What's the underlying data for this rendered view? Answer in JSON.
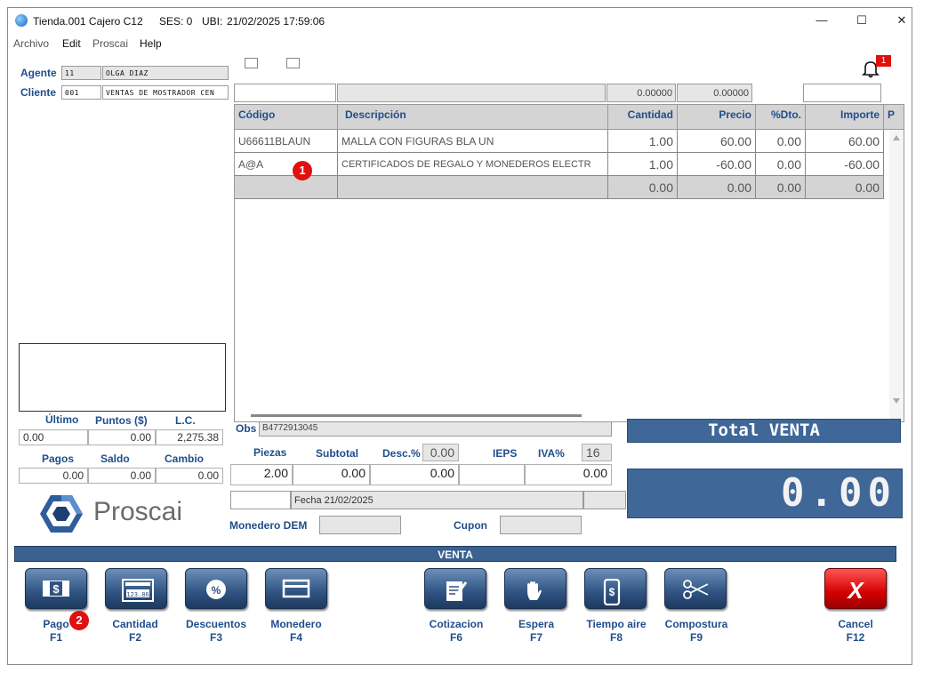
{
  "window": {
    "title": "Tienda.001  Cajero C12",
    "ses": "SES: 0",
    "ubi": "UBI:",
    "datetime": "21/02/2025 17:59:06",
    "controls": {
      "minimize": "—",
      "maximize": "☐",
      "close": "✕"
    }
  },
  "menu": {
    "items": [
      "Archivo",
      "Edit",
      "Proscai",
      "Help"
    ]
  },
  "customer": {
    "agente_label": "Agente",
    "agente_code": "11",
    "agente_name": "OLGA DIAZ",
    "cliente_label": "Cliente",
    "cliente_code": "001",
    "cliente_name": "VENTAS DE MOSTRADOR CEN"
  },
  "notification": {
    "count": "1"
  },
  "top_fields": {
    "val1": "0.00000",
    "val2": "0.00000"
  },
  "grid": {
    "headers": [
      "Código",
      "Descripción",
      "Cantidad",
      "Precio",
      "%Dto.",
      "Importe",
      "P"
    ],
    "rows": [
      {
        "codigo": "U66611BLAUN",
        "descripcion": "MALLA CON FIGURAS BLA UN",
        "cantidad": "1.00",
        "precio": "60.00",
        "dto": "0.00",
        "importe": "60.00"
      },
      {
        "codigo": "A@A",
        "descripcion": "CERTIFICADOS DE REGALO Y MONEDEROS ELECTR",
        "cantidad": "1.00",
        "precio": "-60.00",
        "dto": "0.00",
        "importe": "-60.00"
      },
      {
        "codigo": "",
        "descripcion": "",
        "cantidad": "0.00",
        "precio": "0.00",
        "dto": "0.00",
        "importe": "0.00"
      }
    ]
  },
  "markers": {
    "m1": "1",
    "m2": "2"
  },
  "left_stats": {
    "ultimo_label": "Último",
    "puntos_label": "Puntos ($)",
    "lc_label": "L.C.",
    "ultimo": "0.00",
    "puntos": "0.00",
    "lc": "2,275.38",
    "pagos_label": "Pagos",
    "saldo_label": "Saldo",
    "cambio_label": "Cambio",
    "pagos": "0.00",
    "saldo": "0.00",
    "cambio": "0.00"
  },
  "logo": {
    "text": "Proscai"
  },
  "summary": {
    "obs_label": "Obs",
    "obs_value": "B4772913045",
    "piezas_label": "Piezas",
    "subtotal_label": "Subtotal",
    "desc_label": "Desc.%",
    "desc_value": "0.00",
    "ieps_label": "IEPS",
    "iva_label": "IVA%",
    "iva_value": "16",
    "piezas": "2.00",
    "subtotal": "0.00",
    "desc_amount": "0.00",
    "total_value": "0.00",
    "fecha": "Fecha 21/02/2025",
    "monedero_label": "Monedero DEM",
    "cupon_label": "Cupon"
  },
  "total": {
    "label": "Total VENTA",
    "value": "0.00"
  },
  "mode_bar": "VENTA",
  "buttons": [
    {
      "label": "Pago",
      "key": "F1",
      "icon": "cash-icon"
    },
    {
      "label": "Cantidad",
      "key": "F2",
      "icon": "calculator-icon"
    },
    {
      "label": "Descuentos",
      "key": "F3",
      "icon": "percent-icon"
    },
    {
      "label": "Monedero",
      "key": "F4",
      "icon": "card-icon"
    },
    {
      "label": "Cotizacion",
      "key": "F6",
      "icon": "quote-edit-icon"
    },
    {
      "label": "Espera",
      "key": "F7",
      "icon": "hand-icon"
    },
    {
      "label": "Tiempo aire",
      "key": "F8",
      "icon": "phone-icon"
    },
    {
      "label": "Compostura",
      "key": "F9",
      "icon": "scissors-icon"
    },
    {
      "label": "Cancel",
      "key": "F12",
      "icon": "cancel-x-icon"
    }
  ],
  "colors": {
    "accent": "#1f4e8c",
    "bar": "#3f6797",
    "cancel": "#d40000"
  }
}
